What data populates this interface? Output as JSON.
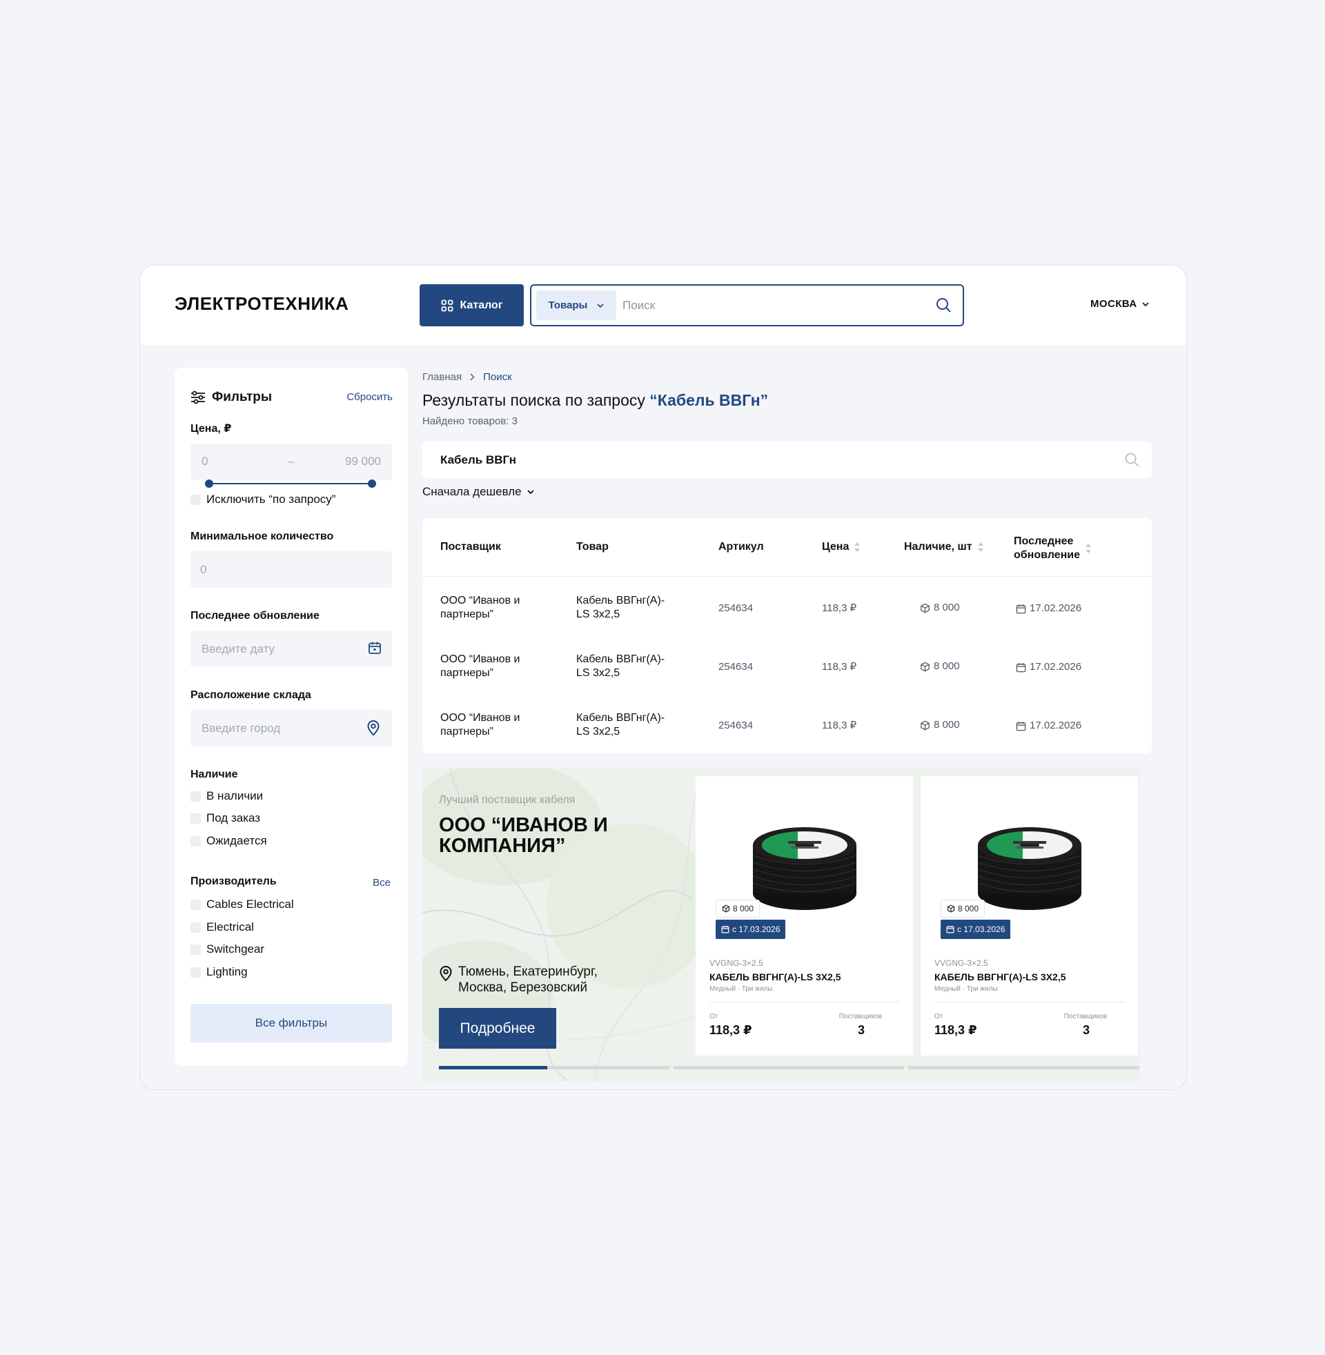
{
  "header": {
    "logo": "ЭЛЕКТРОТЕХНИКА",
    "catalog_label": "Каталог",
    "search_type": "Товары",
    "search_placeholder": "Поиск",
    "city": "МОСКВА"
  },
  "filters": {
    "title": "Фильтры",
    "reset": "Сбросить",
    "price_label": "Цена, ₽",
    "price_min": "0",
    "price_dash": "–",
    "price_max": "99 000",
    "exclude_on_request": "Исключить “по запросу”",
    "min_qty_label": "Минимальное количество",
    "min_qty_placeholder": "0",
    "last_update_label": "Последнее обновление",
    "date_placeholder": "Введите дату",
    "warehouse_label": "Расположение склада",
    "city_placeholder": "Введите город",
    "availability_label": "Наличие",
    "availability": [
      "В наличии",
      "Под заказ",
      "Ожидается"
    ],
    "manufacturer_label": "Производитель",
    "manufacturer_all": "Все",
    "manufacturers": [
      "Cables Electrical",
      "Electrical",
      "Switchgear",
      "Lighting"
    ],
    "all_filters": "Все фильтры"
  },
  "breadcrumbs": [
    "Главная",
    "Поиск"
  ],
  "results": {
    "title_prefix": "Результаты поиска по запросу ",
    "query": "“Кабель ВВГн”",
    "found": "Найдено товаров: 3",
    "search_value": "Кабель ВВГн",
    "sort": "Сначала дешевле"
  },
  "table": {
    "headers": [
      "Поставщик",
      "Товар",
      "Артикул",
      "Цена",
      "Наличие, шт",
      "Последнее\nобновление"
    ],
    "rows": [
      {
        "supplier": "ООО “Иванов и\nпартнеры”",
        "product": "Кабель ВВГнг(А)-\nLS 3х2,5",
        "sku": "254634",
        "price": "118,3 ₽",
        "stock": "8 000",
        "updated": "17.02.2026"
      },
      {
        "supplier": "ООО “Иванов и\nпартнеры”",
        "product": "Кабель ВВГнг(А)-\nLS 3х2,5",
        "sku": "254634",
        "price": "118,3 ₽",
        "stock": "8 000",
        "updated": "17.02.2026"
      },
      {
        "supplier": "ООО “Иванов и\nпартнеры”",
        "product": "Кабель ВВГнг(А)-\nLS 3х2,5",
        "sku": "254634",
        "price": "118,3 ₽",
        "stock": "8 000",
        "updated": "17.02.2026"
      }
    ]
  },
  "promo": {
    "subtitle": "Лучший поставщик кабеля",
    "company": "ООО “ИВАНОВ И\nКОМПАНИЯ”",
    "locations": "Тюмень, Екатеринбург,\nМосква, Березовский",
    "more_button": "Подробнее",
    "slide_progress": 0.47,
    "cards": [
      {
        "stock": "8 000",
        "date": "с 17.03.2026",
        "sku": "VVGNG-3×2.5",
        "title": "КАБЕЛЬ ВВГНГ(А)-LS 3Х2,5",
        "desc": "Медный · Три жилы",
        "from_label": "От",
        "price": "118,3 ₽",
        "suppliers_label": "Поставщиков",
        "suppliers": "3"
      },
      {
        "stock": "8 000",
        "date": "с 17.03.2026",
        "sku": "VVGNG-3×2.5",
        "title": "КАБЕЛЬ ВВГНГ(А)-LS 3Х2,5",
        "desc": "Медный · Три жилы",
        "from_label": "От",
        "price": "118,3 ₽",
        "suppliers_label": "Поставщиков",
        "suppliers": "3"
      }
    ]
  },
  "colors": {
    "brand": "#23487f",
    "page_bg": "#f3f5f9",
    "light_accent": "#e3ebf8"
  }
}
